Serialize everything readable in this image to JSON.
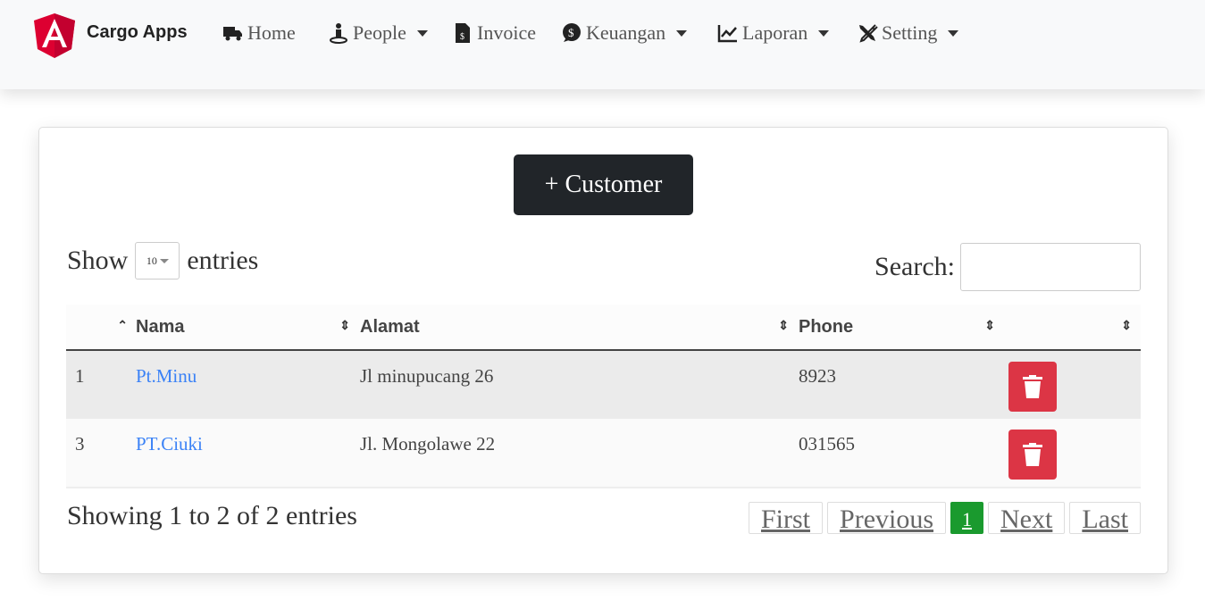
{
  "navbar": {
    "brand": "Cargo Apps",
    "items": [
      {
        "label": "Home",
        "icon": "truck-icon",
        "dropdown": false
      },
      {
        "label": "People",
        "icon": "person-icon",
        "dropdown": true
      },
      {
        "label": "Invoice",
        "icon": "invoice-icon",
        "dropdown": false
      },
      {
        "label": "Keuangan",
        "icon": "dollar-comment-icon",
        "dropdown": true
      },
      {
        "label": "Laporan",
        "icon": "chart-line-icon",
        "dropdown": true
      },
      {
        "label": "Setting",
        "icon": "tools-icon",
        "dropdown": true
      }
    ]
  },
  "add_button": "+ Customer",
  "length": {
    "prefix": "Show",
    "value": "10",
    "suffix": "entries"
  },
  "search": {
    "label": "Search:",
    "value": ""
  },
  "table": {
    "headers": [
      "",
      "Nama",
      "Alamat",
      "Phone",
      ""
    ],
    "rows": [
      {
        "id": "1",
        "nama": "Pt.Minu",
        "alamat": "Jl minupucang 26",
        "phone": "8923"
      },
      {
        "id": "3",
        "nama": "PT.Ciuki",
        "alamat": "Jl. Mongolawe 22",
        "phone": "031565"
      }
    ]
  },
  "info": "Showing 1 to 2 of 2 entries",
  "pagination": {
    "first": "First",
    "previous": "Previous",
    "current": "1",
    "next": "Next",
    "last": "Last"
  },
  "colors": {
    "brand": "#dd0031",
    "delete": "#dc3545",
    "active_page": "#1a9a2e",
    "button": "#212529"
  }
}
